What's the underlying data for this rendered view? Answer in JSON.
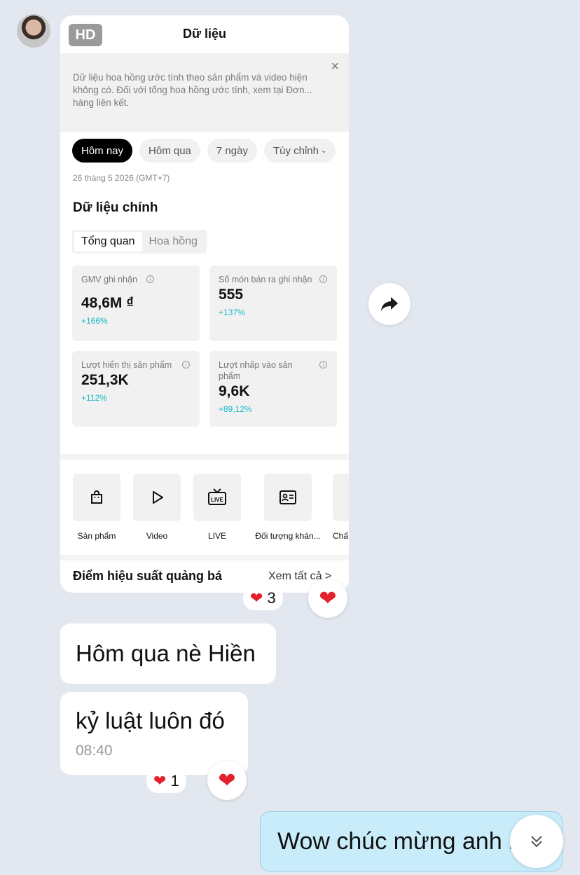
{
  "card": {
    "hd": "HD",
    "title": "Dữ liệu",
    "notice": "Dữ liệu hoa hồng ước tính theo sản phẩm và video hiện không có. Đối với tổng hoa hồng ước tính, xem tại Đơn... hàng liên kết.",
    "close": "×",
    "chips": [
      "Hôm nay",
      "Hôm qua",
      "7 ngày",
      "Tùy chỉnh"
    ],
    "date": "26 tháng 5 2026 (GMT+7)",
    "section_title": "Dữ liệu chính",
    "segments": [
      "Tổng quan",
      "Hoa hồng"
    ],
    "metrics": [
      {
        "label": "GMV ghi nhận",
        "value": "48,6M ₫",
        "change": "+166%"
      },
      {
        "label": "Số món bán ra ghi nhận",
        "value": "555",
        "change": "+137%"
      },
      {
        "label": "Lượt hiển thị sản phẩm",
        "value": "251,3K",
        "change": "+112%"
      },
      {
        "label": "Lượt nhấp vào sản phẩm",
        "value": "9,6K",
        "change": "+89,12%"
      }
    ],
    "tools": [
      {
        "label": "Sản phẩm",
        "icon": "shopping-bag-icon"
      },
      {
        "label": "Video",
        "icon": "play-icon"
      },
      {
        "label": "LIVE",
        "icon": "live-tv-icon"
      },
      {
        "label": "Đối tượng khán...",
        "icon": "audience-card-icon"
      },
      {
        "label": "Chấ",
        "icon": "more-icon"
      }
    ],
    "perf_title": "Điểm hiệu suất quảng bá",
    "see_all": "Xem tất cả >"
  },
  "reactions": {
    "card_count": "3",
    "msg2_count": "1"
  },
  "messages": {
    "msg1": "Hôm qua nè Hiền",
    "msg2": "kỷ luật luôn đó",
    "msg2_time": "08:40",
    "outgoing": "Wow chúc mừng anh n"
  },
  "colors": {
    "background": "#e3e8f0",
    "outgoing_bubble": "#c9ecfb",
    "change_text": "#1bb8c4",
    "heart": "#e4202c"
  }
}
